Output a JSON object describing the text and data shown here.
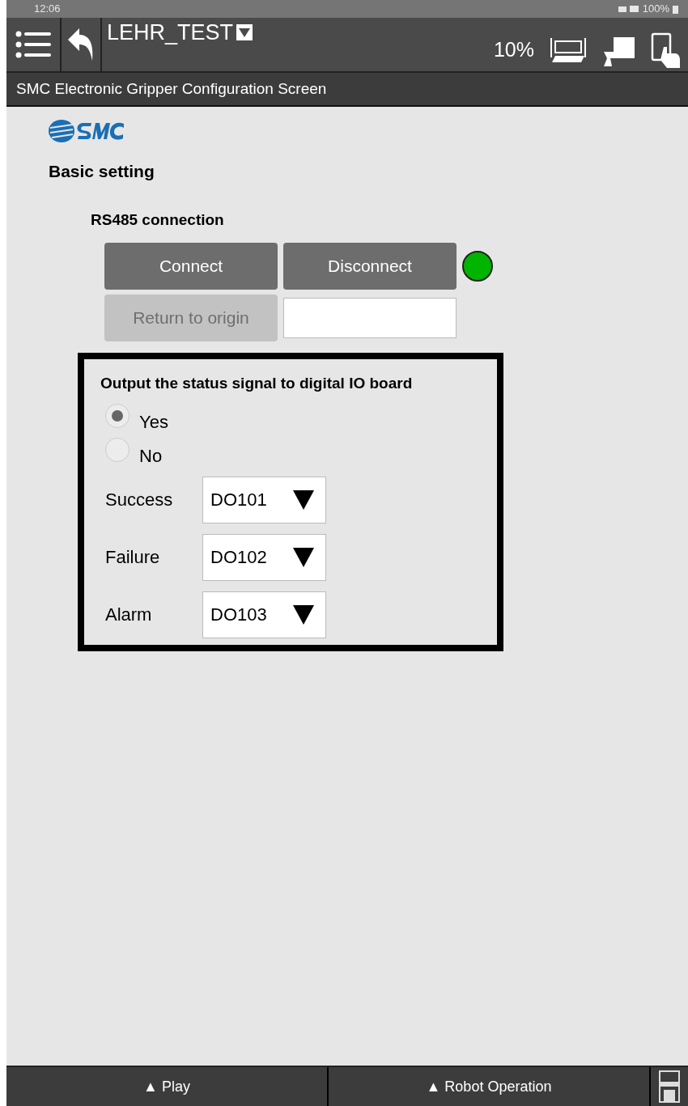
{
  "status_bar": {
    "time": "12:06",
    "battery": "100%"
  },
  "header": {
    "title": "LEHR_TEST",
    "speed": "10%"
  },
  "subtitle": "SMC Electronic Gripper Configuration Screen",
  "section_title": "Basic setting",
  "rs485": {
    "title": "RS485 connection",
    "buttons": [
      {
        "label": "Connect",
        "disabled": false
      },
      {
        "label": "Disconnect",
        "disabled": false
      }
    ],
    "led_on": true,
    "origin_button": {
      "label": "Return to origin",
      "disabled": true
    }
  },
  "output_box": {
    "title": "Output the status signal to digital IO board",
    "options": [
      {
        "label": "Yes",
        "selected": true
      },
      {
        "label": "No",
        "selected": false
      }
    ],
    "signals": [
      {
        "label": "Success",
        "value": "DO101"
      },
      {
        "label": "Failure",
        "value": "DO102"
      },
      {
        "label": "Alarm",
        "value": "DO103"
      }
    ]
  },
  "bottom_bar": [
    "▲ Play",
    "▲ Robot Operation"
  ]
}
